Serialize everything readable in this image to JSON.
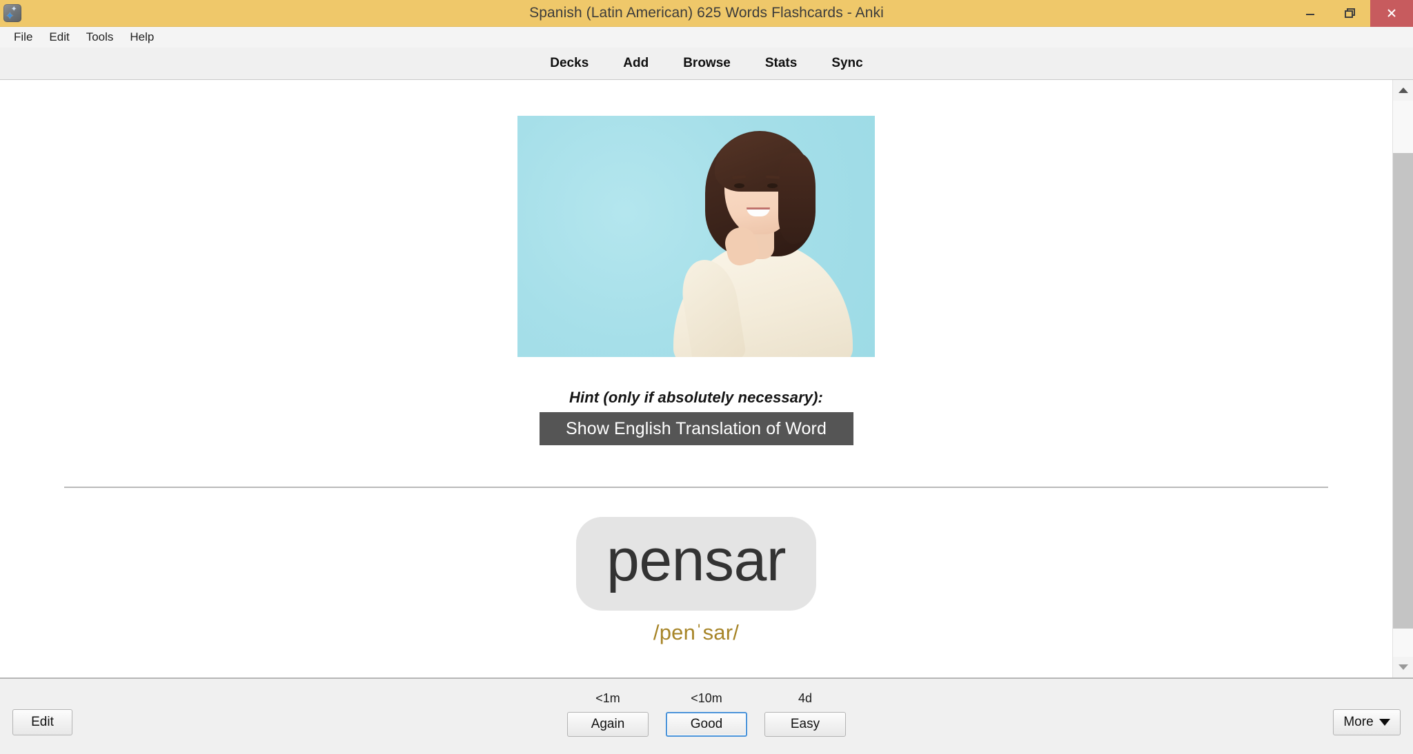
{
  "window": {
    "title": "Spanish (Latin American) 625 Words Flashcards - Anki",
    "app_icon": "anki-icon",
    "titlebar_color": "#efc86a",
    "close_button_color": "#c75b5e",
    "controls": {
      "minimize": "minimize-icon",
      "maximize": "restore-icon",
      "close": "close-icon"
    }
  },
  "menubar": {
    "items": [
      {
        "label": "File"
      },
      {
        "label": "Edit"
      },
      {
        "label": "Tools"
      },
      {
        "label": "Help"
      }
    ]
  },
  "topnav": {
    "items": [
      {
        "label": "Decks"
      },
      {
        "label": "Add"
      },
      {
        "label": "Browse"
      },
      {
        "label": "Stats"
      },
      {
        "label": "Sync"
      }
    ]
  },
  "card": {
    "clipped_top_text": "",
    "image_alt": "thinking-woman-photo",
    "image_bg_color": "#a6dfe9",
    "hint_label": "Hint (only if absolutely necessary):",
    "hint_button_label": "Show English Translation of Word",
    "hint_button_color": "#555555",
    "answer_word": "pensar",
    "answer_word_pill_color": "#e4e4e4",
    "pronunciation": "/penˈsar/",
    "pronunciation_color": "#a78528"
  },
  "scrollbar": {
    "up_arrow": "chevron-up-icon",
    "down_arrow": "chevron-down-icon"
  },
  "bottombar": {
    "edit_label": "Edit",
    "more_label": "More",
    "more_caret": "caret-down-icon",
    "ease_buttons": [
      {
        "time": "<1m",
        "label": "Again",
        "focused": false
      },
      {
        "time": "<10m",
        "label": "Good",
        "focused": true
      },
      {
        "time": "4d",
        "label": "Easy",
        "focused": false
      }
    ]
  }
}
